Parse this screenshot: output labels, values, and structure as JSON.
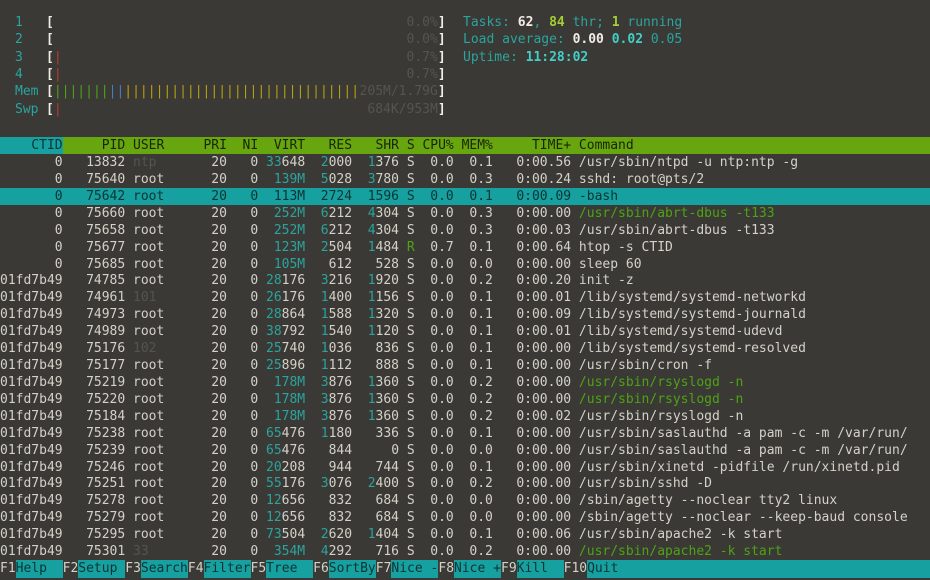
{
  "colors": {
    "background": "#3a3935",
    "text": "#d4d1c8",
    "dim_text": "#56544c",
    "accent_cyan": "#17a0a0",
    "cyan_text": "#2ba49e",
    "bright_cyan": "#43cfc8",
    "header_green": "#68a60f",
    "thread_green": "#4ea315",
    "bright_green": "#a6cf35",
    "alert_red": "#c03b2e",
    "bar_yellow": "#b8a00e",
    "bar_blue": "#4a7cba"
  },
  "meters": {
    "rows": [
      {
        "id": "cpu1",
        "label": "1",
        "segments": [],
        "value": "0.0%"
      },
      {
        "id": "cpu2",
        "label": "2",
        "segments": [],
        "value": "0.0%"
      },
      {
        "id": "cpu3",
        "label": "3",
        "segments": [
          {
            "color": "red",
            "count": 1
          }
        ],
        "value": "0.7%"
      },
      {
        "id": "cpu4",
        "label": "4",
        "segments": [
          {
            "color": "red",
            "count": 1
          }
        ],
        "value": "0.7%"
      },
      {
        "id": "memory",
        "label": "Mem",
        "segments": [
          {
            "color": "green",
            "count": 7
          },
          {
            "color": "blue",
            "count": 2
          },
          {
            "color": "yellow",
            "count": 30
          }
        ],
        "value": "205M/1.79G"
      },
      {
        "id": "swap",
        "label": "Swp",
        "segments": [
          {
            "color": "red",
            "count": 1
          }
        ],
        "value": "684K/953M"
      }
    ]
  },
  "sysinfo": {
    "line_names": [
      "tasks-summary",
      "load-average",
      "uptime"
    ],
    "lines": [
      [
        {
          "t": "Tasks: ",
          "c": "cyan"
        },
        {
          "t": "62",
          "c": "whiteb"
        },
        {
          "t": ", ",
          "c": "cyan"
        },
        {
          "t": "84",
          "c": "greenb"
        },
        {
          "t": " thr; ",
          "c": "cyan"
        },
        {
          "t": "1",
          "c": "greenb"
        },
        {
          "t": " running",
          "c": "cyan"
        }
      ],
      [
        {
          "t": "Load average: ",
          "c": "cyan"
        },
        {
          "t": "0.00 ",
          "c": "whiteb"
        },
        {
          "t": "0.02 ",
          "c": "cyanb"
        },
        {
          "t": "0.05",
          "c": "cyan"
        }
      ],
      [
        {
          "t": "Uptime: ",
          "c": "cyan"
        },
        {
          "t": "11:28:02",
          "c": "cyanb"
        }
      ]
    ]
  },
  "table": {
    "columns": [
      {
        "key": "ctid",
        "label": "CTID",
        "width": 8,
        "align": "right",
        "gap": 1,
        "sort": true
      },
      {
        "key": "pid",
        "label": "PID",
        "width": 7,
        "align": "right",
        "gap": 1
      },
      {
        "key": "user",
        "label": "USER",
        "width": 9,
        "align": "left",
        "gap": 0
      },
      {
        "key": "pri",
        "label": "PRI",
        "width": 3,
        "align": "right",
        "gap": 1
      },
      {
        "key": "ni",
        "label": "NI",
        "width": 3,
        "align": "right",
        "gap": 1
      },
      {
        "key": "virt",
        "label": "VIRT",
        "width": 5,
        "align": "right",
        "gap": 1
      },
      {
        "key": "res",
        "label": "RES",
        "width": 5,
        "align": "right",
        "gap": 1
      },
      {
        "key": "shr",
        "label": "SHR",
        "width": 5,
        "align": "right",
        "gap": 1
      },
      {
        "key": "s",
        "label": "S",
        "width": 1,
        "align": "left",
        "gap": 1
      },
      {
        "key": "cpu",
        "label": "CPU%",
        "width": 4,
        "align": "right",
        "gap": 1
      },
      {
        "key": "mem",
        "label": "MEM%",
        "width": 4,
        "align": "right",
        "gap": 1
      },
      {
        "key": "time",
        "label": "TIME+",
        "width": 9,
        "align": "right",
        "gap": 1
      },
      {
        "key": "command",
        "label": "Command",
        "width": 0,
        "align": "left",
        "gap": 0
      }
    ],
    "processes": [
      {
        "ctid": "0",
        "pid": "13832",
        "user": "ntp",
        "pri": "20",
        "ni": "0",
        "virt": "33648",
        "res": "2000",
        "shr": "1376",
        "s": "S",
        "cpu": "0.0",
        "mem": "0.1",
        "time": "0:00.56",
        "command": "/usr/sbin/ntpd -u ntp:ntp -g"
      },
      {
        "ctid": "0",
        "pid": "75640",
        "user": "root",
        "pri": "20",
        "ni": "0",
        "virt": "139M",
        "res": "5028",
        "shr": "3780",
        "s": "S",
        "cpu": "0.0",
        "mem": "0.3",
        "time": "0:00.24",
        "command": "sshd: root@pts/2"
      },
      {
        "ctid": "0",
        "pid": "75642",
        "user": "root",
        "pri": "20",
        "ni": "0",
        "virt": "113M",
        "res": "2724",
        "shr": "1596",
        "s": "S",
        "cpu": "0.0",
        "mem": "0.1",
        "time": "0:00.09",
        "command": "-bash",
        "selected": true
      },
      {
        "ctid": "0",
        "pid": "75660",
        "user": "root",
        "pri": "20",
        "ni": "0",
        "virt": "252M",
        "res": "6212",
        "shr": "4304",
        "s": "S",
        "cpu": "0.0",
        "mem": "0.3",
        "time": "0:00.00",
        "command": "/usr/sbin/abrt-dbus -t133",
        "thread": true
      },
      {
        "ctid": "0",
        "pid": "75658",
        "user": "root",
        "pri": "20",
        "ni": "0",
        "virt": "252M",
        "res": "6212",
        "shr": "4304",
        "s": "S",
        "cpu": "0.0",
        "mem": "0.3",
        "time": "0:00.03",
        "command": "/usr/sbin/abrt-dbus -t133"
      },
      {
        "ctid": "0",
        "pid": "75677",
        "user": "root",
        "pri": "20",
        "ni": "0",
        "virt": "123M",
        "res": "2504",
        "shr": "1484",
        "s": "R",
        "cpu": "0.7",
        "mem": "0.1",
        "time": "0:00.64",
        "command": "htop -s CTID"
      },
      {
        "ctid": "0",
        "pid": "75685",
        "user": "root",
        "pri": "20",
        "ni": "0",
        "virt": "105M",
        "res": "612",
        "shr": "528",
        "s": "S",
        "cpu": "0.0",
        "mem": "0.0",
        "time": "0:00.00",
        "command": "sleep 60"
      },
      {
        "ctid": "01fd7b49",
        "pid": "74785",
        "user": "root",
        "pri": "20",
        "ni": "0",
        "virt": "28176",
        "res": "3216",
        "shr": "1920",
        "s": "S",
        "cpu": "0.0",
        "mem": "0.2",
        "time": "0:00.20",
        "command": "init -z"
      },
      {
        "ctid": "01fd7b49",
        "pid": "74961",
        "user": "101",
        "pri": "20",
        "ni": "0",
        "virt": "26176",
        "res": "1400",
        "shr": "1156",
        "s": "S",
        "cpu": "0.0",
        "mem": "0.1",
        "time": "0:00.01",
        "command": "/lib/systemd/systemd-networkd"
      },
      {
        "ctid": "01fd7b49",
        "pid": "74973",
        "user": "root",
        "pri": "20",
        "ni": "0",
        "virt": "28864",
        "res": "1588",
        "shr": "1320",
        "s": "S",
        "cpu": "0.0",
        "mem": "0.1",
        "time": "0:00.09",
        "command": "/lib/systemd/systemd-journald"
      },
      {
        "ctid": "01fd7b49",
        "pid": "74989",
        "user": "root",
        "pri": "20",
        "ni": "0",
        "virt": "38792",
        "res": "1540",
        "shr": "1120",
        "s": "S",
        "cpu": "0.0",
        "mem": "0.1",
        "time": "0:00.01",
        "command": "/lib/systemd/systemd-udevd"
      },
      {
        "ctid": "01fd7b49",
        "pid": "75176",
        "user": "102",
        "pri": "20",
        "ni": "0",
        "virt": "25740",
        "res": "1036",
        "shr": "836",
        "s": "S",
        "cpu": "0.0",
        "mem": "0.1",
        "time": "0:00.00",
        "command": "/lib/systemd/systemd-resolved"
      },
      {
        "ctid": "01fd7b49",
        "pid": "75177",
        "user": "root",
        "pri": "20",
        "ni": "0",
        "virt": "25896",
        "res": "1112",
        "shr": "888",
        "s": "S",
        "cpu": "0.0",
        "mem": "0.1",
        "time": "0:00.00",
        "command": "/usr/sbin/cron -f"
      },
      {
        "ctid": "01fd7b49",
        "pid": "75219",
        "user": "root",
        "pri": "20",
        "ni": "0",
        "virt": "178M",
        "res": "3876",
        "shr": "1360",
        "s": "S",
        "cpu": "0.0",
        "mem": "0.2",
        "time": "0:00.00",
        "command": "/usr/sbin/rsyslogd -n",
        "thread": true
      },
      {
        "ctid": "01fd7b49",
        "pid": "75220",
        "user": "root",
        "pri": "20",
        "ni": "0",
        "virt": "178M",
        "res": "3876",
        "shr": "1360",
        "s": "S",
        "cpu": "0.0",
        "mem": "0.2",
        "time": "0:00.00",
        "command": "/usr/sbin/rsyslogd -n",
        "thread": true
      },
      {
        "ctid": "01fd7b49",
        "pid": "75184",
        "user": "root",
        "pri": "20",
        "ni": "0",
        "virt": "178M",
        "res": "3876",
        "shr": "1360",
        "s": "S",
        "cpu": "0.0",
        "mem": "0.2",
        "time": "0:00.02",
        "command": "/usr/sbin/rsyslogd -n"
      },
      {
        "ctid": "01fd7b49",
        "pid": "75238",
        "user": "root",
        "pri": "20",
        "ni": "0",
        "virt": "65476",
        "res": "1180",
        "shr": "336",
        "s": "S",
        "cpu": "0.0",
        "mem": "0.1",
        "time": "0:00.00",
        "command": "/usr/sbin/saslauthd -a pam -c -m /var/run/"
      },
      {
        "ctid": "01fd7b49",
        "pid": "75239",
        "user": "root",
        "pri": "20",
        "ni": "0",
        "virt": "65476",
        "res": "844",
        "shr": "0",
        "s": "S",
        "cpu": "0.0",
        "mem": "0.0",
        "time": "0:00.00",
        "command": "/usr/sbin/saslauthd -a pam -c -m /var/run/"
      },
      {
        "ctid": "01fd7b49",
        "pid": "75246",
        "user": "root",
        "pri": "20",
        "ni": "0",
        "virt": "20208",
        "res": "944",
        "shr": "744",
        "s": "S",
        "cpu": "0.0",
        "mem": "0.1",
        "time": "0:00.00",
        "command": "/usr/sbin/xinetd -pidfile /run/xinetd.pid"
      },
      {
        "ctid": "01fd7b49",
        "pid": "75251",
        "user": "root",
        "pri": "20",
        "ni": "0",
        "virt": "55176",
        "res": "3076",
        "shr": "2400",
        "s": "S",
        "cpu": "0.0",
        "mem": "0.2",
        "time": "0:00.00",
        "command": "/usr/sbin/sshd -D"
      },
      {
        "ctid": "01fd7b49",
        "pid": "75278",
        "user": "root",
        "pri": "20",
        "ni": "0",
        "virt": "12656",
        "res": "832",
        "shr": "684",
        "s": "S",
        "cpu": "0.0",
        "mem": "0.0",
        "time": "0:00.00",
        "command": "/sbin/agetty --noclear tty2 linux"
      },
      {
        "ctid": "01fd7b49",
        "pid": "75279",
        "user": "root",
        "pri": "20",
        "ni": "0",
        "virt": "12656",
        "res": "832",
        "shr": "684",
        "s": "S",
        "cpu": "0.0",
        "mem": "0.0",
        "time": "0:00.00",
        "command": "/sbin/agetty --noclear --keep-baud console"
      },
      {
        "ctid": "01fd7b49",
        "pid": "75295",
        "user": "root",
        "pri": "20",
        "ni": "0",
        "virt": "73504",
        "res": "2620",
        "shr": "1404",
        "s": "S",
        "cpu": "0.0",
        "mem": "0.1",
        "time": "0:00.06",
        "command": "/usr/sbin/apache2 -k start"
      },
      {
        "ctid": "01fd7b49",
        "pid": "75301",
        "user": "33",
        "pri": "20",
        "ni": "0",
        "virt": "354M",
        "res": "4292",
        "shr": "716",
        "s": "S",
        "cpu": "0.0",
        "mem": "0.2",
        "time": "0:00.00",
        "command": "/usr/sbin/apache2 -k start",
        "thread": true
      }
    ]
  },
  "function_keys": [
    {
      "key": "F1",
      "label": "Help"
    },
    {
      "key": "F2",
      "label": "Setup"
    },
    {
      "key": "F3",
      "label": "Search"
    },
    {
      "key": "F4",
      "label": "Filter"
    },
    {
      "key": "F5",
      "label": "Tree"
    },
    {
      "key": "F6",
      "label": "SortBy"
    },
    {
      "key": "F7",
      "label": "Nice -"
    },
    {
      "key": "F8",
      "label": "Nice +"
    },
    {
      "key": "F9",
      "label": "Kill"
    },
    {
      "key": "F10",
      "label": "Quit"
    }
  ]
}
